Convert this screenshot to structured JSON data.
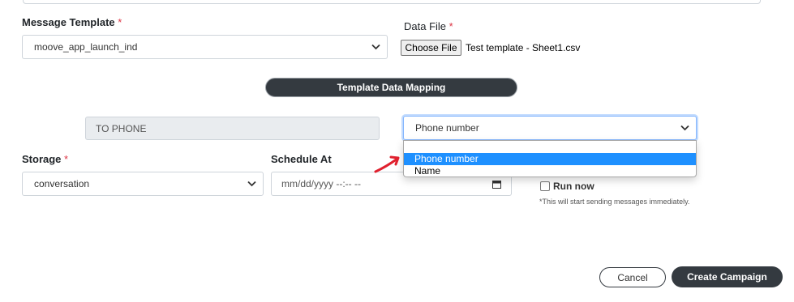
{
  "form": {
    "message_template": {
      "label": "Message Template",
      "required_mark": "*",
      "selected": "moove_app_launch_ind"
    },
    "data_file": {
      "label": "Data File",
      "required_mark": "*",
      "choose_button": "Choose File",
      "file_name": "Test template - Sheet1.csv"
    },
    "mapping_header": "Template Data Mapping",
    "mapping_row": {
      "field_value": "TO PHONE",
      "selected": "Phone number",
      "options": [
        "Phone number",
        "Name"
      ]
    },
    "storage": {
      "label": "Storage",
      "required_mark": "*",
      "selected": "conversation"
    },
    "schedule": {
      "label": "Schedule At",
      "placeholder": "mm/dd/yyyy --:-- --"
    },
    "run_now": {
      "label": "Run now",
      "note": "*This will start sending messages immediately."
    },
    "actions": {
      "cancel": "Cancel",
      "create": "Create Campaign"
    }
  },
  "colors": {
    "dark": "#343a40",
    "required": "#dc3545",
    "option_highlight": "#1e90ff",
    "arrow": "#e0202e"
  }
}
